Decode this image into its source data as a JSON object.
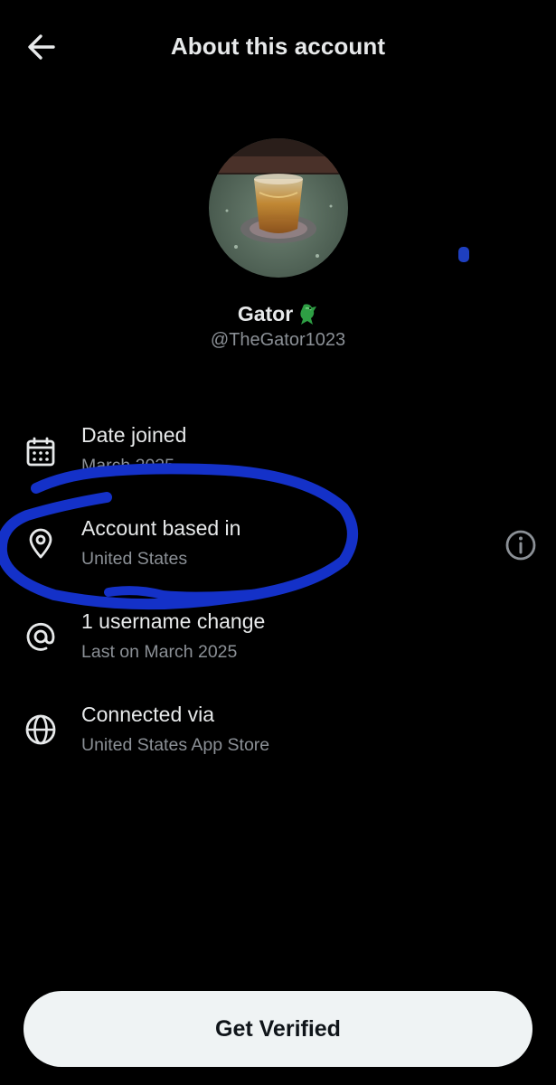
{
  "header": {
    "title": "About this account",
    "back_icon": "arrow-left-icon"
  },
  "profile": {
    "display_name": "Gator",
    "name_emoji": "crocodile-emoji",
    "handle": "@TheGator1023",
    "avatar_description_icon": "avatar-photo"
  },
  "rows": [
    {
      "icon": "calendar-icon",
      "title": "Date joined",
      "value": "March 2025"
    },
    {
      "icon": "location-pin-icon",
      "title": "Account based in",
      "value": "United States",
      "trailing_icon": "info-circle-icon"
    },
    {
      "icon": "at-sign-icon",
      "title": "1 username change",
      "value": "Last on March 2025"
    },
    {
      "icon": "globe-icon",
      "title": "Connected via",
      "value": "United States App Store"
    }
  ],
  "cta": {
    "label": "Get Verified"
  },
  "colors": {
    "background": "#000000",
    "text_primary": "#e7e9ea",
    "text_secondary": "#8b9096",
    "button_bg": "#eff3f4",
    "annotation": "#1431c8"
  }
}
